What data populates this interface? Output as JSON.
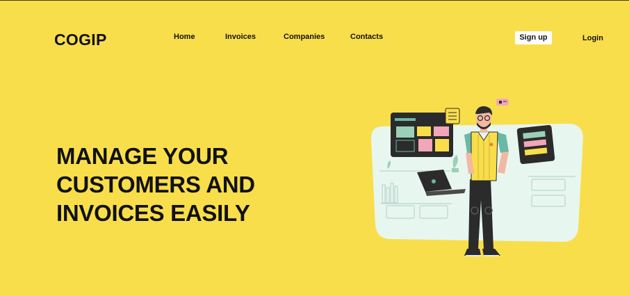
{
  "brand": {
    "name": "COGIP"
  },
  "nav": {
    "items": [
      {
        "label": "Home"
      },
      {
        "label": "Invoices"
      },
      {
        "label": "Companies"
      },
      {
        "label": "Contacts"
      }
    ]
  },
  "auth": {
    "signup_label": "Sign up",
    "login_label": "Login"
  },
  "hero": {
    "lines": [
      "MANAGE YOUR",
      "CUSTOMERS AND",
      "INVOICES EASILY"
    ]
  },
  "colors": {
    "background": "#f9de4b",
    "text": "#111111",
    "button_bg": "#ffffff",
    "illustration_panel": "#e8f6f0"
  },
  "illustration": {
    "icon": "person-with-dashboards-illustration"
  }
}
